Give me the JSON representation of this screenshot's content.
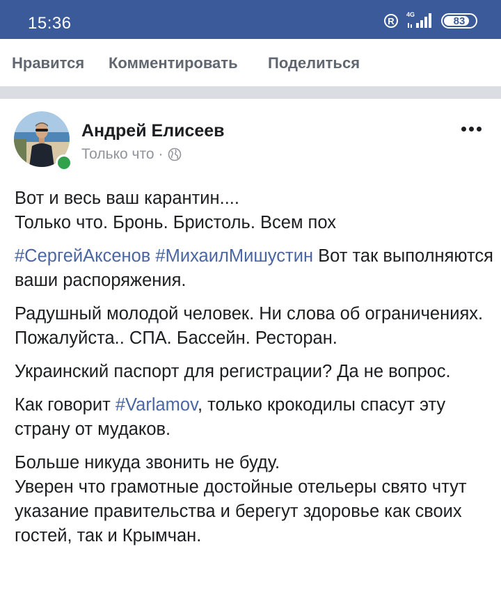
{
  "status_bar": {
    "time": "15:36",
    "network_type": "4G",
    "battery": "83",
    "battery_level": 0.83,
    "background_color": "#3b5a9a",
    "icons": [
      "registered-icon",
      "signal-icon",
      "battery-icon"
    ]
  },
  "action_bar": {
    "like_label": "Нравится",
    "comment_label": "Комментировать",
    "share_label": "Поделиться"
  },
  "post": {
    "author": "Андрей Елисеев",
    "time": "Только что",
    "separator": "·",
    "privacy_icon": "globe-icon",
    "more_icon": "more-horizontal-icon",
    "online_color": "#31a24c",
    "hashtag_color": "#4b67a1",
    "paragraphs": {
      "p1_line1": "Вот и весь ваш карантин....",
      "p1_line2": "Только что. Бронь. Бристоль. Всем пох",
      "p2_tag1": "#СергейАксенов",
      "p2_tag2": "#МихаилМишустин",
      "p2_text": " Вот так выполняются ваши распоряжения.",
      "p3": "Радушный молодой человек. Ни слова об ограничениях. Пожалуйста.. СПА. Бассейн. Ресторан.",
      "p4": "Украинский паспорт для регистрации? Да не вопрос.",
      "p5_before": "Как говорит ",
      "p5_tag": "#Varlamov",
      "p5_after": ", только крокодилы спасут эту страну от мудаков.",
      "p6_line1": "Больше никуда звонить не буду.",
      "p6_line2": "Уверен что грамотные достойные отельеры свято чтут указание правительства и берегут здоровье как своих гостей, так и Крымчан."
    }
  }
}
